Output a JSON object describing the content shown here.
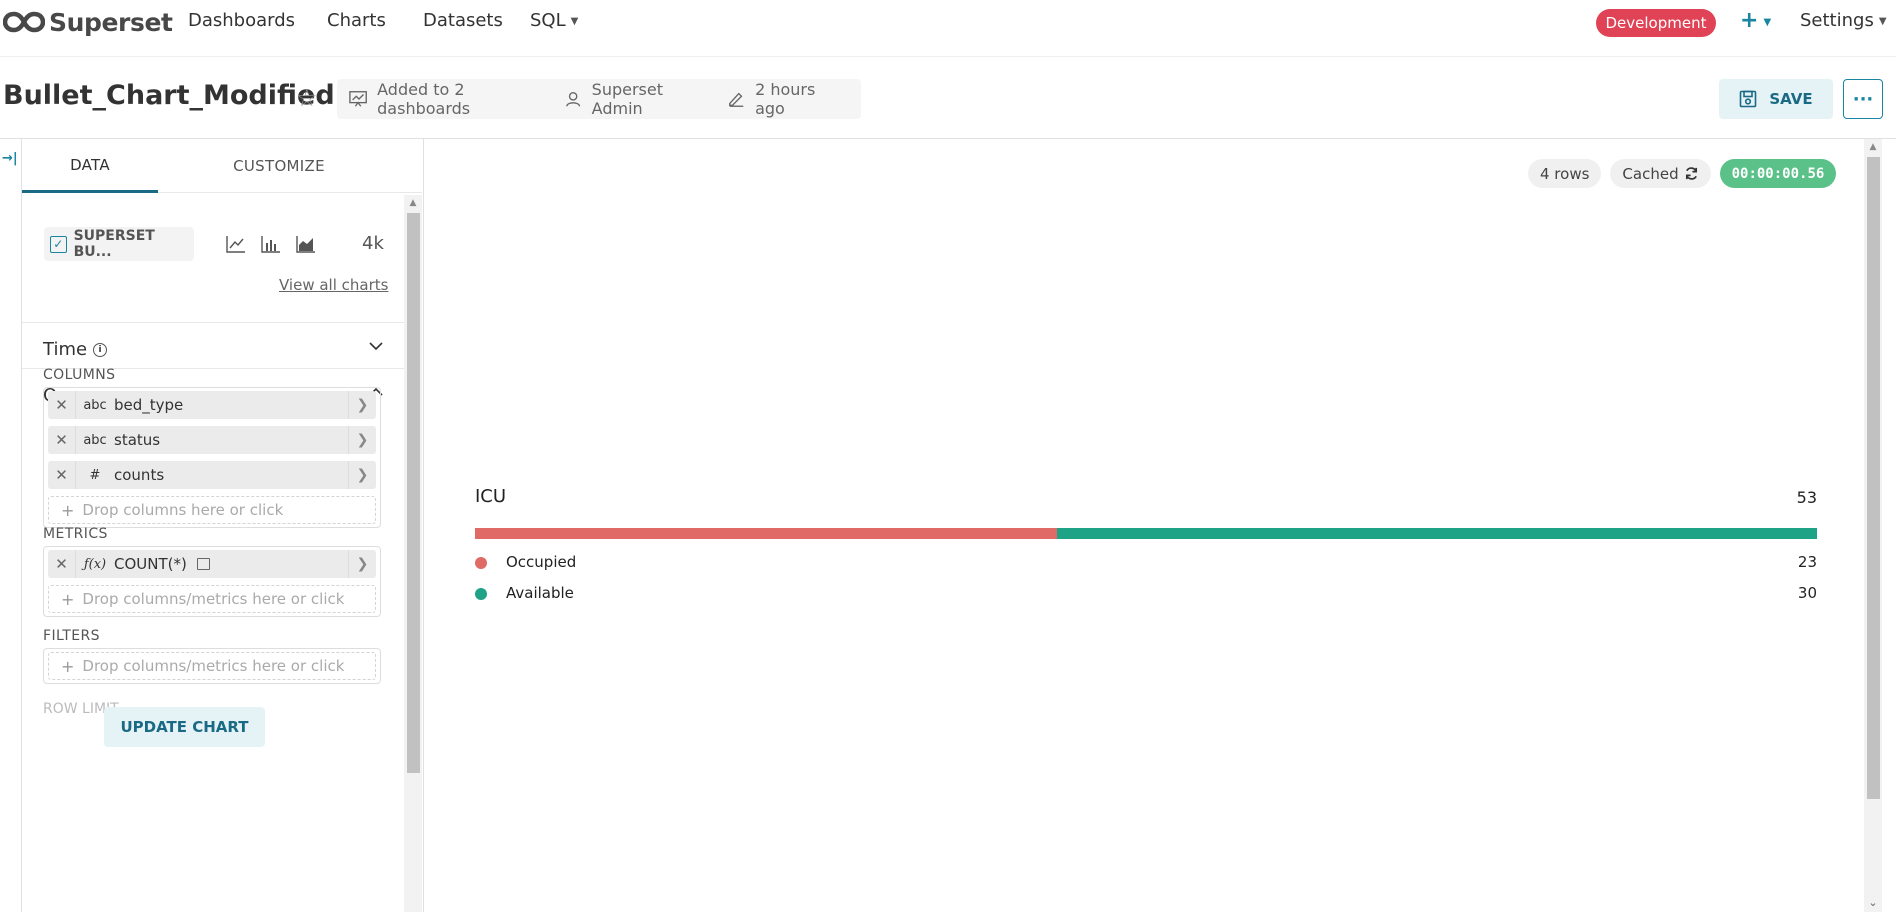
{
  "nav": {
    "brand": "Superset",
    "links": [
      "Dashboards",
      "Charts",
      "Datasets",
      "SQL"
    ],
    "env_badge": "Development",
    "plus": "+",
    "settings": "Settings"
  },
  "header": {
    "title": "Bullet_Chart_Modified",
    "dashboards": "Added to 2 dashboards",
    "owner": "Superset Admin",
    "modified": "2 hours ago",
    "save_label": "SAVE",
    "more_label": "···"
  },
  "panel": {
    "tabs": [
      "DATA",
      "CUSTOMIZE"
    ],
    "viz_name": "SUPERSET BU...",
    "viz_count": "4k",
    "view_all": "View all charts",
    "sections": {
      "time": "Time",
      "query": "Query"
    },
    "columns_label": "COLUMNS",
    "columns": [
      {
        "type": "abc",
        "name": "bed_type"
      },
      {
        "type": "abc",
        "name": "status"
      },
      {
        "type": "#",
        "name": "counts"
      }
    ],
    "columns_drop": "Drop columns here or click",
    "metrics_label": "METRICS",
    "metrics": [
      {
        "type": "ƒ(x)",
        "name": "COUNT(*)"
      }
    ],
    "metrics_drop": "Drop columns/metrics here or click",
    "filters_label": "FILTERS",
    "filters_drop": "Drop columns/metrics here or click",
    "row_limit_label": "ROW LIMIT",
    "update_label": "UPDATE CHART"
  },
  "status": {
    "rows": "4 rows",
    "cached": "Cached",
    "duration": "00:00:00.56"
  },
  "colors": {
    "occupied": "#e06a65",
    "available": "#1fa386",
    "accent": "#1a85a0",
    "env": "#e04355",
    "duration": "#5ac189"
  },
  "chart_data": {
    "type": "bar",
    "title": "ICU",
    "total": 53,
    "categories": [
      "Occupied",
      "Available"
    ],
    "values": [
      23,
      30
    ],
    "orientation": "stacked-horizontal"
  }
}
